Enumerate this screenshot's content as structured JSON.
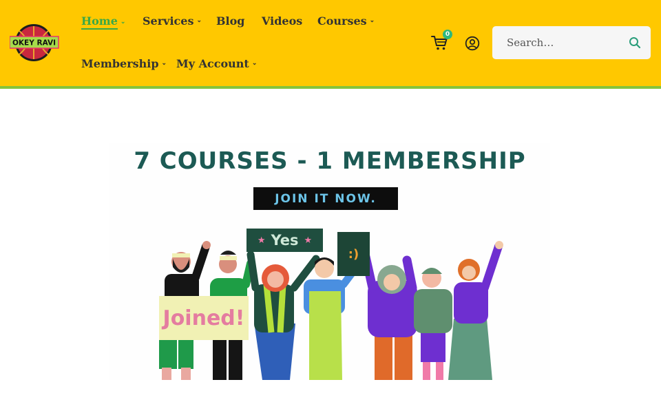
{
  "brand": {
    "logo_text": "OKEY RAVI"
  },
  "nav": [
    {
      "label": "Home",
      "has_dropdown": true,
      "active": true
    },
    {
      "label": "Services",
      "has_dropdown": true
    },
    {
      "label": "Blog",
      "has_dropdown": false
    },
    {
      "label": "Videos",
      "has_dropdown": false
    },
    {
      "label": "Courses",
      "has_dropdown": true
    },
    {
      "label": "Membership",
      "has_dropdown": true
    },
    {
      "label": "My Account",
      "has_dropdown": true
    }
  ],
  "cart": {
    "count": "0",
    "icon": "cart-icon"
  },
  "account": {
    "icon": "user-circle-icon"
  },
  "search": {
    "placeholder": "Search…",
    "icon": "search-icon"
  },
  "banner": {
    "title": "7 COURSES - 1 MEMBERSHIP",
    "cta": "JOIN IT NOW.",
    "sign_yes": "Yes",
    "sign_smile": ":)",
    "sign_joined": "Joined!"
  },
  "colors": {
    "header_bg": "#ffc800",
    "accent_green": "#3aa847",
    "header_underline": "#86c43a",
    "badge": "#2fb87d"
  }
}
